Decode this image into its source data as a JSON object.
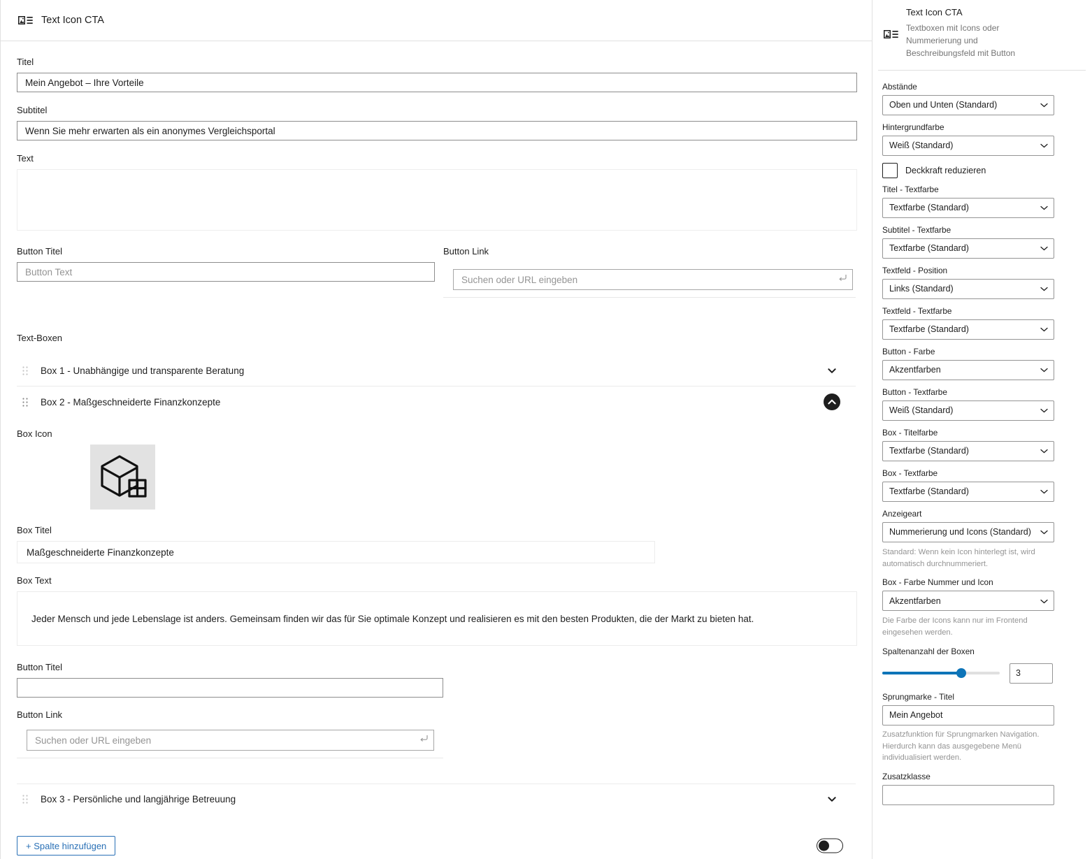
{
  "block": {
    "icon": "media-text-icon",
    "title": "Text Icon CTA"
  },
  "main": {
    "fields": {
      "titel_label": "Titel",
      "titel_value": "Mein Angebot – Ihre Vorteile",
      "subtitel_label": "Subtitel",
      "subtitel_value": "Wenn Sie mehr erwarten als ein anonymes Vergleichsportal",
      "text_label": "Text",
      "text_value": "",
      "button_titel_label": "Button Titel",
      "button_titel_placeholder": "Button Text",
      "button_titel_value": "",
      "button_link_label": "Button Link",
      "button_link_placeholder": "Suchen oder URL eingeben",
      "button_link_value": ""
    },
    "textboxen_label": "Text-Boxen",
    "boxes": [
      {
        "title": "Box 1 - Unabhängige und transparente Beratung",
        "expanded": false,
        "chevron": "chevron-down-icon"
      },
      {
        "title": "Box 2 - Maßgeschneiderte Finanzkonzepte",
        "expanded": true,
        "chevron": "chevron-up-icon"
      },
      {
        "title": "Box 3 - Persönliche und langjährige Betreuung",
        "expanded": false,
        "chevron": "chevron-down-icon"
      }
    ],
    "box2": {
      "box_icon_label": "Box Icon",
      "box_icon_name": "cube-icon",
      "box_titel_label": "Box Titel",
      "box_titel_value": "Maßgeschneiderte Finanzkonzepte",
      "box_text_label": "Box Text",
      "box_text_value": "Jeder Mensch und jede Lebenslage ist anders. Gemeinsam finden wir das für Sie optimale Konzept und realisieren es mit den besten Produkten, die der Markt zu bieten hat.",
      "button_titel_label": "Button Titel",
      "button_titel_value": "",
      "button_link_label": "Button Link",
      "button_link_placeholder": "Suchen oder URL eingeben",
      "button_link_value": ""
    },
    "add_column_button": "+ Spalte hinzufügen",
    "toggle_state": "off"
  },
  "sidebar": {
    "header": {
      "icon": "media-text-icon",
      "title": "Text Icon CTA",
      "description": "Textboxen mit Icons oder Nummerierung und Beschreibungsfeld mit Button"
    },
    "controls": [
      {
        "type": "select",
        "name": "abstaende",
        "label": "Abstände",
        "value": "Oben und Unten (Standard)"
      },
      {
        "type": "select",
        "name": "hintergrundfarbe",
        "label": "Hintergrundfarbe",
        "value": "Weiß (Standard)"
      },
      {
        "type": "checkbox",
        "name": "deckkraft-reduzieren",
        "label": "Deckkraft reduzieren",
        "checked": false
      },
      {
        "type": "select",
        "name": "titel-textfarbe",
        "label": "Titel - Textfarbe",
        "value": "Textfarbe (Standard)"
      },
      {
        "type": "select",
        "name": "subtitel-textfarbe",
        "label": "Subtitel - Textfarbe",
        "value": "Textfarbe (Standard)"
      },
      {
        "type": "select",
        "name": "textfeld-position",
        "label": "Textfeld - Position",
        "value": "Links (Standard)"
      },
      {
        "type": "select",
        "name": "textfeld-textfarbe",
        "label": "Textfeld - Textfarbe",
        "value": "Textfarbe (Standard)"
      },
      {
        "type": "select",
        "name": "button-farbe",
        "label": "Button - Farbe",
        "value": "Akzentfarben"
      },
      {
        "type": "select",
        "name": "button-textfarbe",
        "label": "Button - Textfarbe",
        "value": "Weiß (Standard)"
      },
      {
        "type": "select",
        "name": "box-titelfarbe",
        "label": "Box - Titelfarbe",
        "value": "Textfarbe (Standard)"
      },
      {
        "type": "select",
        "name": "box-textfarbe",
        "label": "Box - Textfarbe",
        "value": "Textfarbe (Standard)"
      },
      {
        "type": "select",
        "name": "anzeigeart",
        "label": "Anzeigeart",
        "value": "Nummerierung und Icons (Standard)"
      }
    ],
    "anzeigeart_help": "Standard: Wenn kein Icon hinterlegt ist, wird automatisch durchnummeriert.",
    "box_farbe": {
      "label": "Box - Farbe Nummer und Icon",
      "value": "Akzentfarben"
    },
    "box_farbe_help": "Die Farbe der Icons kann nur im Frontend eingesehen werden.",
    "spalten": {
      "label": "Spaltenanzahl der Boxen",
      "value": "3",
      "min": 1,
      "max": 4
    },
    "sprungmarke": {
      "label": "Sprungmarke - Titel",
      "value": "Mein Angebot"
    },
    "sprungmarke_help": "Zusatzfunktion für Sprungmarken Navigation. Hierdurch kann das ausgegebene Menü individualisiert werden.",
    "zusatzklasse": {
      "label": "Zusatzklasse",
      "value": ""
    }
  },
  "colors": {
    "accent_blue": "#0d74b8",
    "link_blue": "#2970b6",
    "border": "#8d8d8d",
    "muted_text": "#757575",
    "dark": "#1e1e1e"
  }
}
